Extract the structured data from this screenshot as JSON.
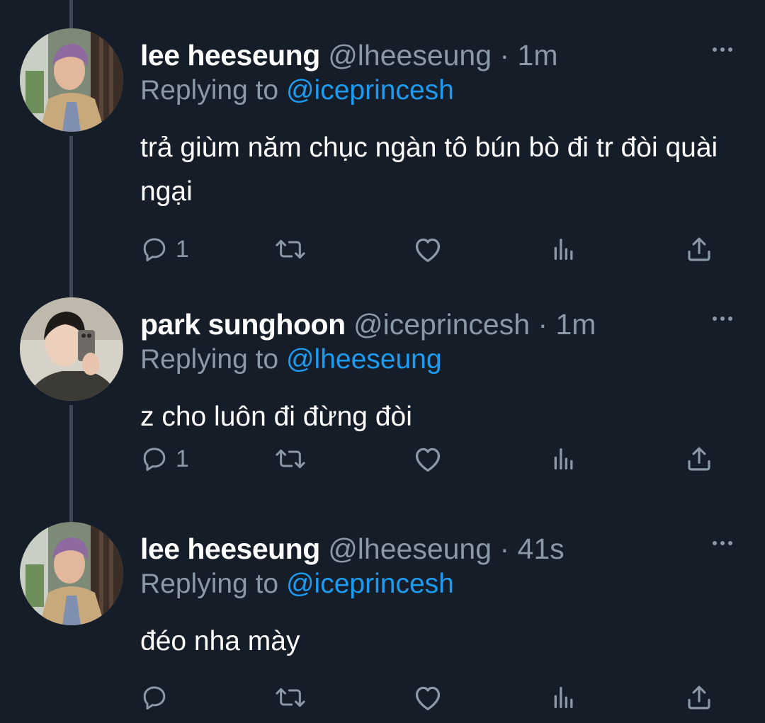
{
  "tweets": [
    {
      "name": "lee heeseung",
      "handle": "@lheeseung",
      "separator": "·",
      "time": "1m",
      "replying_prefix": "Replying to",
      "replying_to": "@iceprincesh",
      "text": "trả giùm năm chục ngàn tô bún bò đi tr đòi quài ngại",
      "reply_count": "1",
      "avatar": "avatar-lee-heeseung"
    },
    {
      "name": "park sunghoon",
      "handle": "@iceprincesh",
      "separator": "·",
      "time": "1m",
      "replying_prefix": "Replying to",
      "replying_to": "@lheeseung",
      "text": "z cho luôn đi đừng đòi",
      "reply_count": "1",
      "avatar": "avatar-park-sunghoon"
    },
    {
      "name": "lee heeseung",
      "handle": "@lheeseung",
      "separator": "·",
      "time": "41s",
      "replying_prefix": "Replying to",
      "replying_to": "@iceprincesh",
      "text": "đéo nha mày",
      "reply_count": "",
      "avatar": "avatar-lee-heeseung"
    }
  ],
  "icons": {
    "reply": "reply-icon",
    "retweet": "retweet-icon",
    "like": "heart-icon",
    "views": "views-icon",
    "share": "share-icon",
    "more": "more-icon"
  },
  "colors": {
    "background": "#151d28",
    "text": "#ffffff",
    "muted": "#8b98a5",
    "accent": "#1d9bf0",
    "thread_line": "#3e4753"
  }
}
